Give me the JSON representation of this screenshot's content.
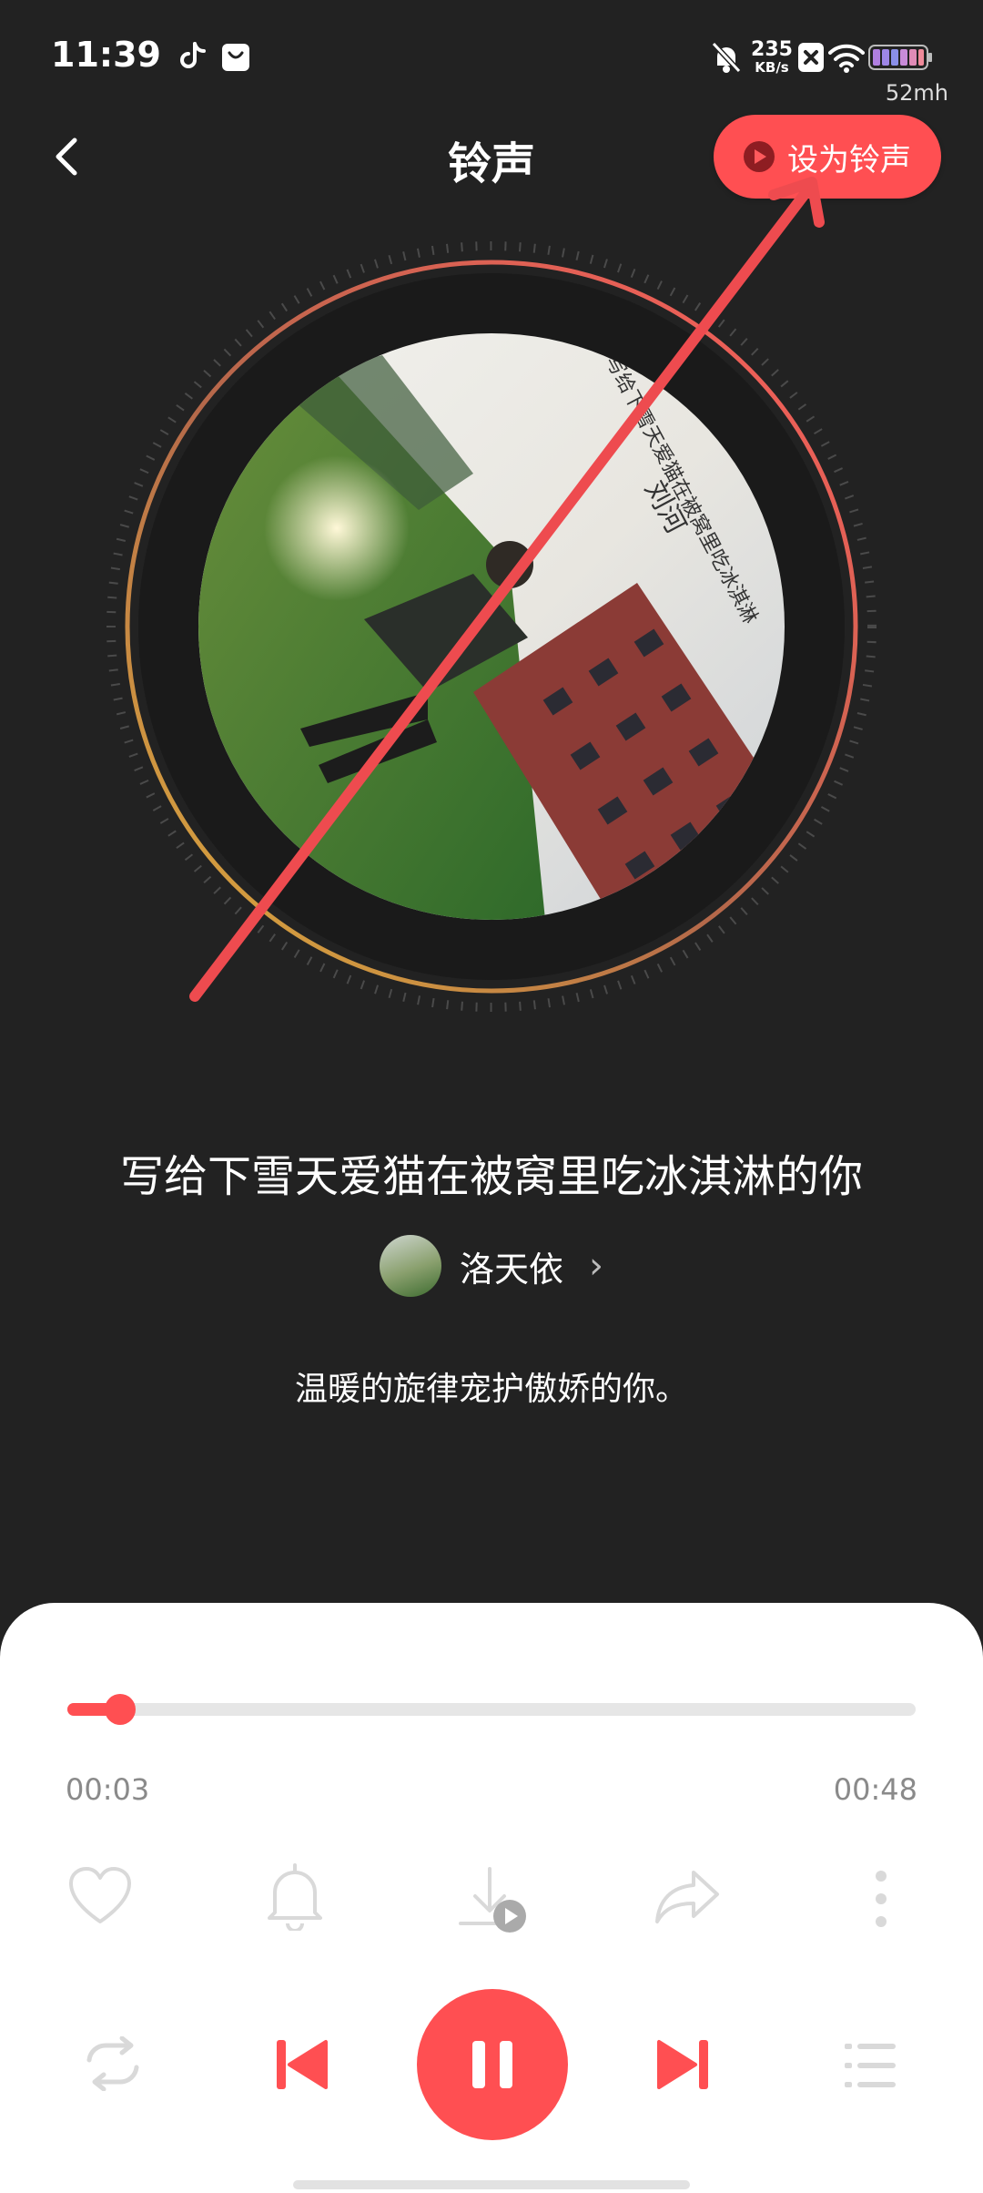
{
  "status_bar": {
    "time": "11:39",
    "network_speed_value": "235",
    "network_speed_unit": "KB/s",
    "battery_label": "52mh"
  },
  "header": {
    "title": "铃声",
    "set_ringtone_label": "设为铃声"
  },
  "album_art": {
    "overlay_text_line1": "写给下雪天爱猫在被窝里吃冰淇淋",
    "overlay_text_line2": "刘河"
  },
  "song": {
    "title": "写给下雪天爱猫在被窝里吃冰淇淋的你",
    "artist": "洛天依",
    "artist_arrow": "›",
    "description": "温暖的旋律宠护傲娇的你。"
  },
  "player": {
    "current_time": "00:03",
    "total_time": "00:48",
    "progress": 0.0625
  },
  "icons": {
    "back": "back-arrow-icon",
    "like": "heart-icon",
    "ringtone": "bell-icon",
    "download": "download-icon",
    "share": "share-icon",
    "more": "more-vertical-icon",
    "repeat": "repeat-icon",
    "previous": "previous-icon",
    "pause": "pause-icon",
    "next": "next-icon",
    "playlist": "playlist-icon"
  },
  "colors": {
    "accent": "#ff4f52",
    "background": "#222222",
    "panel": "#ffffff"
  }
}
